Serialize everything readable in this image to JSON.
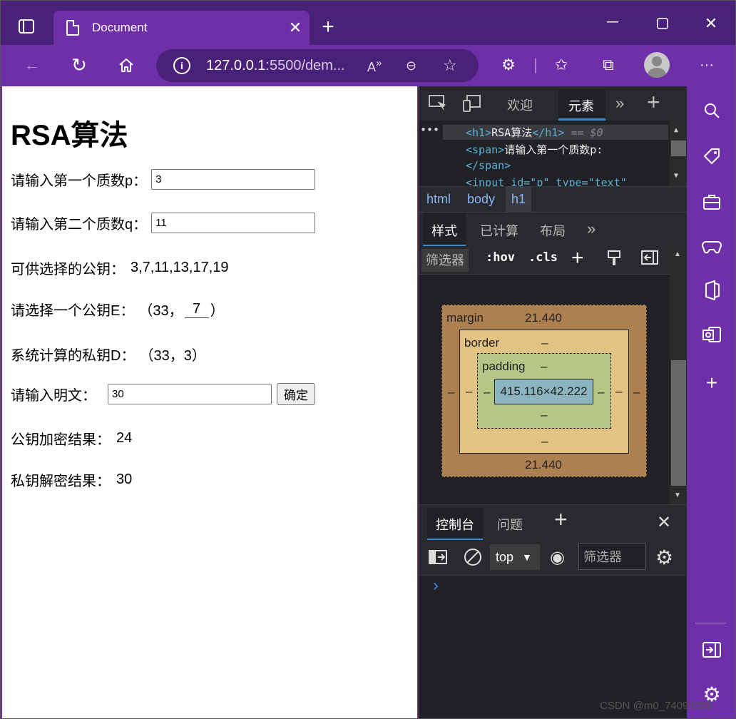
{
  "browser": {
    "tab_title": "Document",
    "url_host": "127.0.0.1",
    "url_rest": ":5500/dem..."
  },
  "page": {
    "heading": "RSA算法",
    "p_label": "请输入第一个质数p：",
    "p_value": "3",
    "q_label": "请输入第二个质数q：",
    "q_value": "11",
    "pubkeys_label": "可供选择的公钥：",
    "pubkeys_value": "3,7,11,13,17,19",
    "e_label": "请选择一个公钥E：",
    "e_prefix": "（33，",
    "e_value": "7",
    "e_suffix": "）",
    "d_label": "系统计算的私钥D：",
    "d_value": "（33，3）",
    "plain_label": "请输入明文：",
    "plain_value": "30",
    "confirm_label": "确定",
    "enc_label": "公钥加密结果：",
    "enc_value": "24",
    "dec_label": "私钥解密结果：",
    "dec_value": "30"
  },
  "devtools": {
    "tab_welcome": "欢迎",
    "tab_elements": "元素",
    "code_line1_open": "<h1>",
    "code_line1_text": "RSA算法",
    "code_line1_close": "</h1>",
    "code_line1_ref": "== $0",
    "code_line2_open": "<span>",
    "code_line2_text": "请输入第一个质数p:",
    "code_line3": "</span>",
    "code_line4": "<input id=\"p\" type=\"text\"",
    "crumb_html": "html",
    "crumb_body": "body",
    "crumb_h1": "h1",
    "styles_tab": "样式",
    "computed_tab": "已计算",
    "layout_tab": "布局",
    "filter_placeholder": "筛选器",
    "hov": ":hov",
    "cls": ".cls",
    "box": {
      "margin_label": "margin",
      "margin_top": "21.440",
      "margin_bottom": "21.440",
      "margin_side": "–",
      "border_label": "border",
      "border_value": "–",
      "padding_label": "padding",
      "padding_value": "–",
      "content_size": "415.116×42.222"
    },
    "console_tab": "控制台",
    "issues_tab": "问题",
    "context_select": "top",
    "console_filter": "筛选器",
    "prompt": "›"
  },
  "watermark": "CSDN @m0_74096029"
}
